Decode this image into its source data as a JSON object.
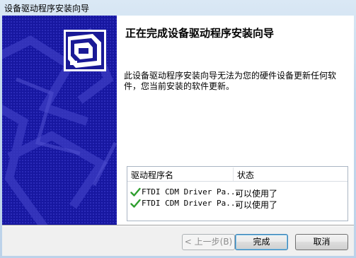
{
  "window": {
    "title": "设备驱动程序安装向导"
  },
  "wizard": {
    "heading": "正在完成设备驱动程序安装向导",
    "description": "此设备驱动程序安装向导无法为您的硬件设备更新任何软件，您当前安装的软件更新。"
  },
  "driver_list": {
    "columns": [
      "驱动程序名",
      "状态"
    ],
    "rows": [
      {
        "name": "FTDI CDM Driver Pa...",
        "status": "可以使用了",
        "icon": "green-check-icon"
      },
      {
        "name": "FTDI CDM Driver Pa...",
        "status": "可以使用了",
        "icon": "green-check-icon"
      }
    ]
  },
  "buttons": {
    "back": "< 上一步(B)",
    "finish": "完成",
    "cancel": "取消"
  },
  "colors": {
    "side_panel": "#16169e",
    "check": "#2e9e2e"
  }
}
